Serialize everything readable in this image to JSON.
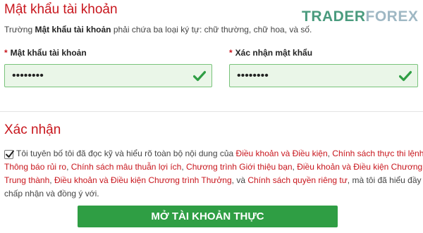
{
  "account_password": {
    "title": "Mật khẩu tài khoản",
    "desc_prefix": "Trường ",
    "desc_bold": "Mật khẩu tài khoản",
    "desc_suffix": " phải chứa ba loại ký tự: chữ thường, chữ hoa, và số.",
    "password_label": "Mật khẩu tài khoản",
    "password_value": "••••••••",
    "confirm_label": "Xác nhận mật khẩu",
    "confirm_value": "••••••••",
    "required_mark": "*"
  },
  "logo": {
    "part1": "TRADER",
    "part2": "FOREX"
  },
  "confirmation": {
    "title": "Xác nhận",
    "checked": true,
    "l1_text1": "Tôi tuyên bố tôi đã đọc kỹ và hiểu rõ toàn bộ nội dung của ",
    "l1_link1": "Điều khoản và Điều kiện",
    "l1_sep1": ", ",
    "l1_link2": "Chính sách thực thi lệnh",
    "l1_sep2": ",",
    "l2_link1": "Thông báo rủi ro",
    "l2_sep1": ", ",
    "l2_link2": "Chính sách mâu thuẫn lợi ích",
    "l2_sep2": ", ",
    "l2_link3": "Chương trình Giới thiệu bạn",
    "l2_sep3": ", ",
    "l2_link4": "Điều khoản và Điều kiện Chương trình",
    "l3_link1": "Trung thành",
    "l3_sep1": ", ",
    "l3_link2": "Điều khoản và Điều kiện Chương trình Thưởng",
    "l3_sep2": ", và ",
    "l3_link3": "Chính sách quyền riêng tư",
    "l3_text": ", mà tôi đã hiểu đầy đủ,",
    "l4_text": "chấp nhận và đồng ý với."
  },
  "cta": {
    "label": "MỞ TÀI KHOẢN THỰC"
  },
  "colors": {
    "accent_red": "#c8161d",
    "valid_green": "#2f9e44",
    "field_bg": "#eaf6e8"
  }
}
